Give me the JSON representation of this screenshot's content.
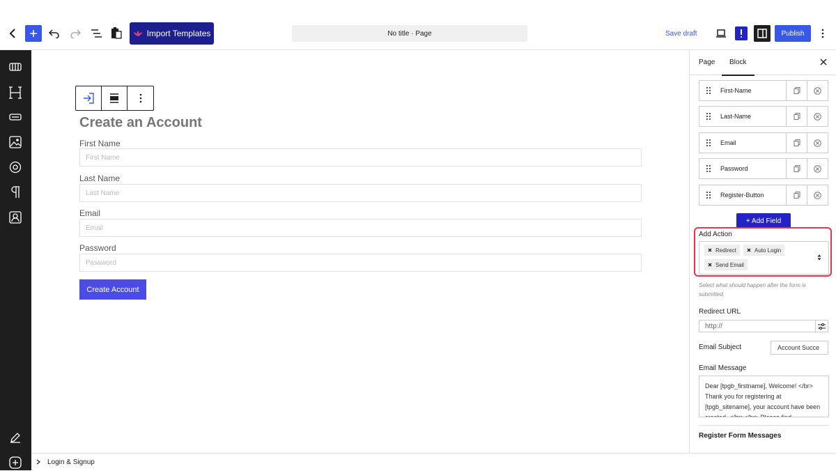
{
  "topbar": {
    "import_label": "Import Templates",
    "doc_title": "No title · Page",
    "save_draft_label": "Save draft",
    "publish_label": "Publish"
  },
  "form": {
    "title": "Create an Account",
    "fields": [
      {
        "label": "First Name",
        "placeholder": "First Name"
      },
      {
        "label": "Last Name",
        "placeholder": "Last Name"
      },
      {
        "label": "Email",
        "placeholder": "Email"
      },
      {
        "label": "Password",
        "placeholder": "Password"
      }
    ],
    "submit_label": "Create Account"
  },
  "footer": {
    "breadcrumb": "Login & Signup"
  },
  "sidebar": {
    "tabs": [
      "Page",
      "Block"
    ],
    "active_tab": "Block",
    "fields": [
      "First-Name",
      "Last-Name",
      "Email",
      "Password",
      "Register-Button"
    ],
    "add_field_label": "+ Add Field",
    "add_action_label": "Add Action",
    "actions": [
      "Redirect",
      "Auto Login",
      "Send Email"
    ],
    "hint": "Select what should happen after the form is submitted.",
    "redirect_url_label": "Redirect URL",
    "redirect_url_placeholder": "http://",
    "email_subject_label": "Email Subject",
    "email_subject_value": "Account Succe",
    "email_message_label": "Email Message",
    "email_message_value": "Dear [tpgb_firstname], Welcome! </br> Thank you for registering at [tpgb_sitename], your account have been created. </br></br> Please find",
    "register_messages_heading": "Register Form Messages"
  },
  "colors": {
    "accent": "#3858e9",
    "import_bg": "#1d1f8f",
    "submit_bg": "#4b4be8",
    "highlight": "#e8334f"
  }
}
